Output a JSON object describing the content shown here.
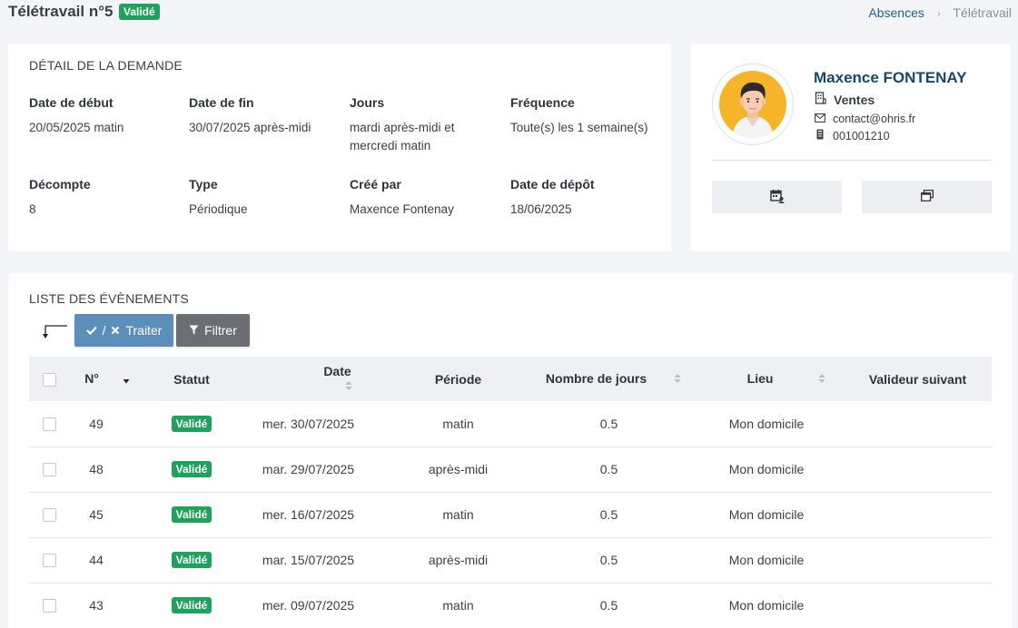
{
  "header": {
    "title": "Télétravail n°5",
    "status_badge": "Validé",
    "breadcrumb": {
      "link": "Absences",
      "current": "Télétravail"
    }
  },
  "detail": {
    "section_title": "DÉTAIL DE LA DEMANDE",
    "fields": [
      {
        "label": "Date de début",
        "value": "20/05/2025 matin"
      },
      {
        "label": "Date de fin",
        "value": "30/07/2025 après-midi"
      },
      {
        "label": "Jours",
        "value": "mardi après-midi et",
        "value2": "mercredi matin"
      },
      {
        "label": "Fréquence",
        "value": "Toute(s) les 1 semaine(s)"
      },
      {
        "label": "Décompte",
        "value": "8"
      },
      {
        "label": "Type",
        "value": "Périodique"
      },
      {
        "label": "Créé par",
        "value": "Maxence Fontenay"
      },
      {
        "label": "Date de dépôt",
        "value": "18/06/2025"
      }
    ]
  },
  "profile": {
    "name": "Maxence FONTENAY",
    "department": "Ventes",
    "email": "contact@ohris.fr",
    "matricule": "001001210",
    "buttons": [
      {
        "icon": "calendar-user-icon"
      },
      {
        "icon": "window-restore-icon"
      }
    ]
  },
  "events": {
    "section_title": "LISTE DES ÉVÈNEMENTS",
    "btn_traiter": "Traiter",
    "btn_traiter_sep": "/",
    "btn_filtrer": "Filtrer",
    "columns": {
      "num": "N°",
      "statut": "Statut",
      "date": "Date",
      "periode": "Période",
      "nb_jours": "Nombre de jours",
      "lieu": "Lieu",
      "valideur": "Valideur suivant"
    },
    "rows": [
      {
        "num": "49",
        "statut": "Validé",
        "date": "mer. 30/07/2025",
        "periode": "matin",
        "nb_jours": "0.5",
        "lieu": "Mon domicile",
        "valideur": ""
      },
      {
        "num": "48",
        "statut": "Validé",
        "date": "mar. 29/07/2025",
        "periode": "après-midi",
        "nb_jours": "0.5",
        "lieu": "Mon domicile",
        "valideur": ""
      },
      {
        "num": "45",
        "statut": "Validé",
        "date": "mer. 16/07/2025",
        "periode": "matin",
        "nb_jours": "0.5",
        "lieu": "Mon domicile",
        "valideur": ""
      },
      {
        "num": "44",
        "statut": "Validé",
        "date": "mar. 15/07/2025",
        "periode": "après-midi",
        "nb_jours": "0.5",
        "lieu": "Mon domicile",
        "valideur": ""
      },
      {
        "num": "43",
        "statut": "Validé",
        "date": "mer. 09/07/2025",
        "periode": "matin",
        "nb_jours": "0.5",
        "lieu": "Mon domicile",
        "valideur": ""
      }
    ]
  },
  "colors": {
    "success": "#1fa35c",
    "primary_button": "#5b8fba",
    "secondary_button": "#6b6f75",
    "name": "#17466e",
    "link": "#1f5f99"
  }
}
